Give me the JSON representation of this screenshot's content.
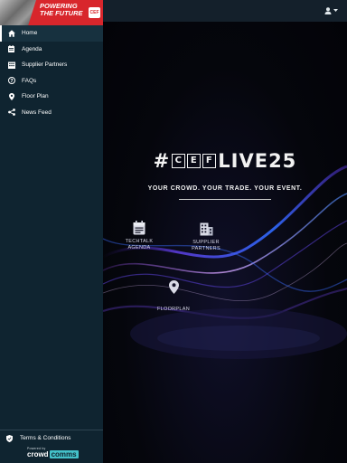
{
  "sidebar": {
    "banner": {
      "title_line1": "POWERING",
      "title_line2": "THE FUTURE",
      "badge": "CEF"
    },
    "items": [
      {
        "label": "Home",
        "icon": "home-icon",
        "active": true
      },
      {
        "label": "Agenda",
        "icon": "calendar-icon"
      },
      {
        "label": "Supplier Partners",
        "icon": "building-icon"
      },
      {
        "label": "FAQs",
        "icon": "help-icon"
      },
      {
        "label": "Floor Plan",
        "icon": "map-pin-icon"
      },
      {
        "label": "News Feed",
        "icon": "share-icon"
      }
    ],
    "footer": {
      "terms_label": "Terms & Conditions",
      "powered_by": "Powered by",
      "brand_part1": "crowd",
      "brand_part2": "comms"
    }
  },
  "header": {
    "user_icon": "user-icon",
    "dropdown_icon": "caret-down-icon"
  },
  "main": {
    "logo": {
      "hash": "#",
      "boxes": [
        "C",
        "E",
        "F"
      ],
      "word": "LIVE25"
    },
    "tagline": "YOUR CROWD. YOUR TRADE. YOUR EVENT.",
    "tiles": [
      {
        "label": "TECHTALK\nAGENDA",
        "icon": "calendar-icon"
      },
      {
        "label": "SUPPLIER\nPARTNERS",
        "icon": "building-icon"
      },
      {
        "label": "FLOORPLAN",
        "icon": "map-pin-icon"
      }
    ]
  },
  "colors": {
    "sidebar_bg": "#0f2430",
    "topbar_bg": "#14202b",
    "banner_red": "#d8262c",
    "accent_teal": "#44c1c9"
  }
}
